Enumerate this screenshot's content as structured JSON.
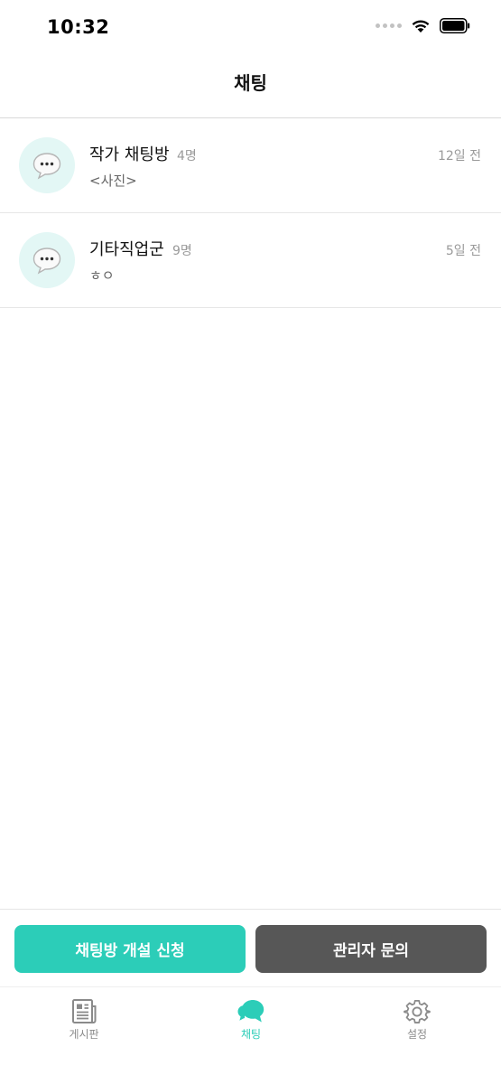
{
  "status_bar": {
    "time": "10:32",
    "icons": [
      "signal-icon",
      "wifi-icon",
      "battery-icon"
    ]
  },
  "header": {
    "title": "채팅"
  },
  "chat_rooms": [
    {
      "name": "작가 채팅방",
      "member_count": "4명",
      "time_ago": "12일 전",
      "last_message": "<사진>",
      "icon": "speech-bubble-icon"
    },
    {
      "name": "기타직업군",
      "member_count": "9명",
      "time_ago": "5일 전",
      "last_message": "ㅎㅇ",
      "icon": "speech-bubble-icon"
    }
  ],
  "actions": {
    "apply_label": "채팅방 개설 신청",
    "contact_label": "관리자 문의"
  },
  "tabs": [
    {
      "label": "게시판",
      "icon": "newspaper-icon",
      "active": false
    },
    {
      "label": "채팅",
      "icon": "chat-bubbles-icon",
      "active": true
    },
    {
      "label": "설정",
      "icon": "gear-icon",
      "active": false
    }
  ],
  "colors": {
    "accent": "#2ccdb8",
    "secondary_button": "#575757",
    "avatar_background": "#e3f7f5",
    "muted_text": "#9a9a9a"
  }
}
